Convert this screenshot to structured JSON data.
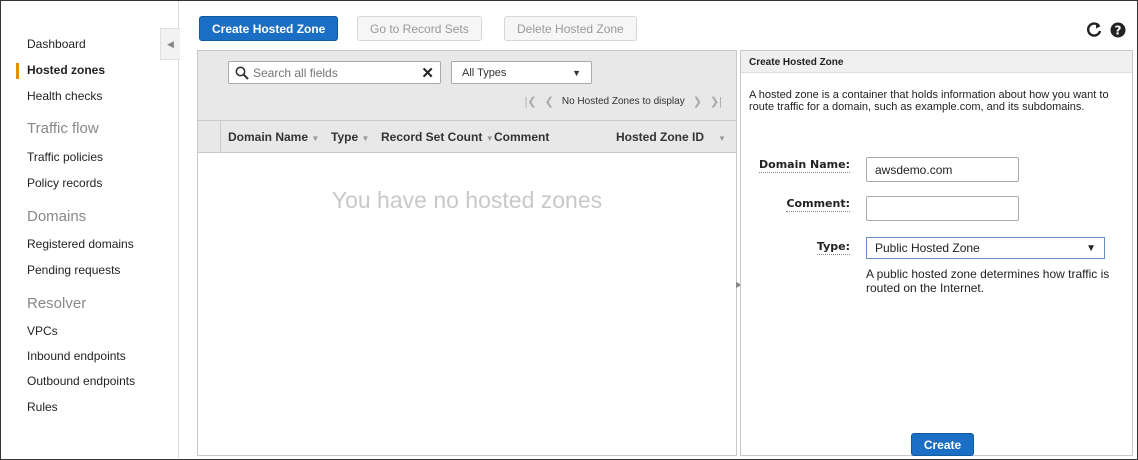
{
  "sidebar": {
    "items": [
      {
        "label": "Dashboard",
        "kind": "link"
      },
      {
        "label": "Hosted zones",
        "kind": "link",
        "active": true
      },
      {
        "label": "Health checks",
        "kind": "link"
      },
      {
        "label": "Traffic flow",
        "kind": "section"
      },
      {
        "label": "Traffic policies",
        "kind": "link"
      },
      {
        "label": "Policy records",
        "kind": "link"
      },
      {
        "label": "Domains",
        "kind": "section"
      },
      {
        "label": "Registered domains",
        "kind": "link"
      },
      {
        "label": "Pending requests",
        "kind": "link"
      },
      {
        "label": "Resolver",
        "kind": "section"
      },
      {
        "label": "VPCs",
        "kind": "link"
      },
      {
        "label": "Inbound endpoints",
        "kind": "link"
      },
      {
        "label": "Outbound endpoints",
        "kind": "link"
      },
      {
        "label": "Rules",
        "kind": "link"
      }
    ]
  },
  "toolbar": {
    "create_label": "Create Hosted Zone",
    "goto_label": "Go to Record Sets",
    "delete_label": "Delete Hosted Zone"
  },
  "top_icons": {
    "refresh": "refresh-icon",
    "help": "help-icon"
  },
  "filter": {
    "search_placeholder": "Search all fields",
    "type_value": "All Types",
    "pager_text": "No Hosted Zones to display"
  },
  "table": {
    "columns": [
      "Domain Name",
      "Type",
      "Record Set Count",
      "Comment",
      "Hosted Zone ID"
    ],
    "empty_message": "You have no hosted zones"
  },
  "form": {
    "title": "Create Hosted Zone",
    "description": "A hosted zone is a container that holds information about how you want to route traffic for a domain, such as example.com, and its subdomains.",
    "domain_label": "Domain Name:",
    "domain_value": "awsdemo.com",
    "comment_label": "Comment:",
    "comment_value": "",
    "type_label": "Type:",
    "type_value": "Public Hosted Zone",
    "type_help": "A public hosted zone determines how traffic is routed on the Internet.",
    "create_label": "Create"
  },
  "colors": {
    "primary": "#1a6fc4",
    "active_marker": "#e98b0f",
    "panel_header": "#e8e8e8"
  }
}
